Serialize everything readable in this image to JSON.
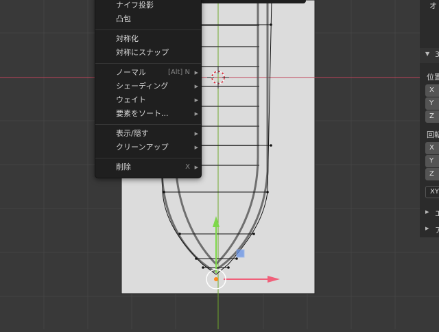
{
  "menu": {
    "items": [
      {
        "label": "ナイフ投影",
        "shortcut": "",
        "arrow": false
      },
      {
        "label": "凸包",
        "shortcut": "",
        "arrow": false
      },
      {
        "label": "対称化",
        "shortcut": "",
        "arrow": false
      },
      {
        "label": "対称にスナップ",
        "shortcut": "",
        "arrow": false
      },
      {
        "label": "ノーマル",
        "shortcut": "[Alt] N",
        "arrow": true
      },
      {
        "label": "シェーディング",
        "shortcut": "",
        "arrow": true
      },
      {
        "label": "ウェイト",
        "shortcut": "",
        "arrow": true
      },
      {
        "label": "要素をソート...",
        "shortcut": "",
        "arrow": true
      },
      {
        "label": "表示/隠す",
        "shortcut": "",
        "arrow": true
      },
      {
        "label": "クリーンアップ",
        "shortcut": "",
        "arrow": true
      },
      {
        "label": "削除",
        "shortcut": "X",
        "arrow": true
      }
    ],
    "arrow_glyph": "▶"
  },
  "npanel": {
    "top_label": "オ",
    "section_transform": "3",
    "location_label": "位置",
    "rotation_label": "回転",
    "axes": [
      "X",
      "Y",
      "Z"
    ],
    "rot_mode": "XY",
    "collapsed_1": "エ",
    "collapsed_2": "ア",
    "expand_glyph": "▼",
    "collapsed_glyph": "▶"
  },
  "colors": {
    "viewport_bg": "#393939",
    "grid_line": "#444444",
    "x_axis": "#c0445a",
    "y_axis": "#6fa82b",
    "image_plane": "#dcdcdc",
    "gizmo_red": "#f0607a",
    "gizmo_green": "#7ed84a",
    "gizmo_blue": "#5f8fe8",
    "menu_bg": "#1f1f1f",
    "menu_text": "#d6d6d6"
  }
}
